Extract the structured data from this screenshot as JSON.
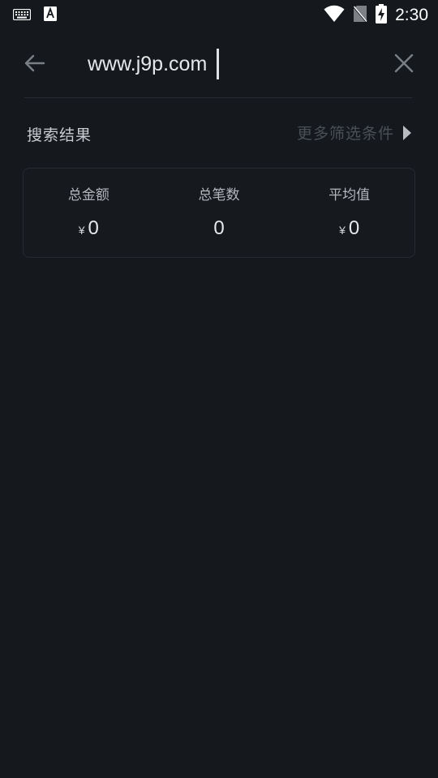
{
  "status_bar": {
    "time": "2:30",
    "left_icons": [
      "keyboard-icon",
      "font-a-icon"
    ],
    "right_icons": [
      "wifi-icon",
      "no-sim-icon",
      "battery-charging-icon"
    ]
  },
  "search": {
    "query": "www.j9p.com",
    "back_icon": "arrow-left-icon",
    "clear_icon": "close-icon"
  },
  "results": {
    "title": "搜索结果",
    "more_filters_label": "更多筛选条件",
    "more_filters_icon": "triangle-right-icon"
  },
  "summary": {
    "total_amount_label": "总金额",
    "total_amount_currency": "¥",
    "total_amount_value": "0",
    "total_count_label": "总笔数",
    "total_count_value": "0",
    "average_label": "平均值",
    "average_currency": "¥",
    "average_value": "0"
  },
  "colors": {
    "background": "#15191e",
    "text_primary": "#e6e8ea",
    "text_muted": "#4a4f56",
    "card_border": "#262b31"
  }
}
